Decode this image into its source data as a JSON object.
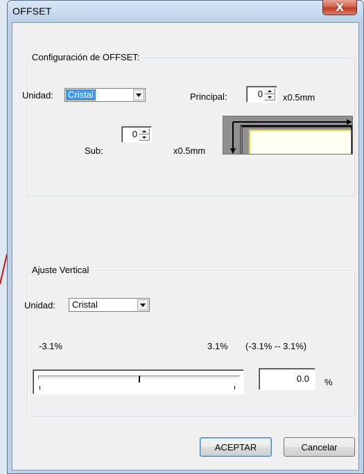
{
  "window": {
    "title": "OFFSET",
    "close_glyph": "X"
  },
  "offset_group": {
    "label": "Configuración de OFFSET:",
    "unit_label": "Unidad:",
    "unit_value": "Cristal",
    "main_label": "Principal:",
    "main_value": "0",
    "main_unit": "x0.5mm",
    "sub_label": "Sub:",
    "sub_value": "0",
    "sub_unit": "x0.5mm",
    "preview_icon": "offset-direction-icon"
  },
  "vertical_group": {
    "label": "Ajuste Vertical",
    "unit_label": "Unidad:",
    "unit_value": "Cristal",
    "min_label": "-3.1%",
    "max_label": "3.1%",
    "range_label": "(-3.1% -- 3.1%)",
    "slider_value": 0.0,
    "value_field": "0.0",
    "value_unit": "%"
  },
  "buttons": {
    "ok": "ACEPTAR",
    "cancel": "Cancelar"
  },
  "colors": {
    "selection": "#3399ff",
    "preview_fill": "#fffff0",
    "preview_border": "#e8d84a",
    "close_button": "#c03b22"
  }
}
